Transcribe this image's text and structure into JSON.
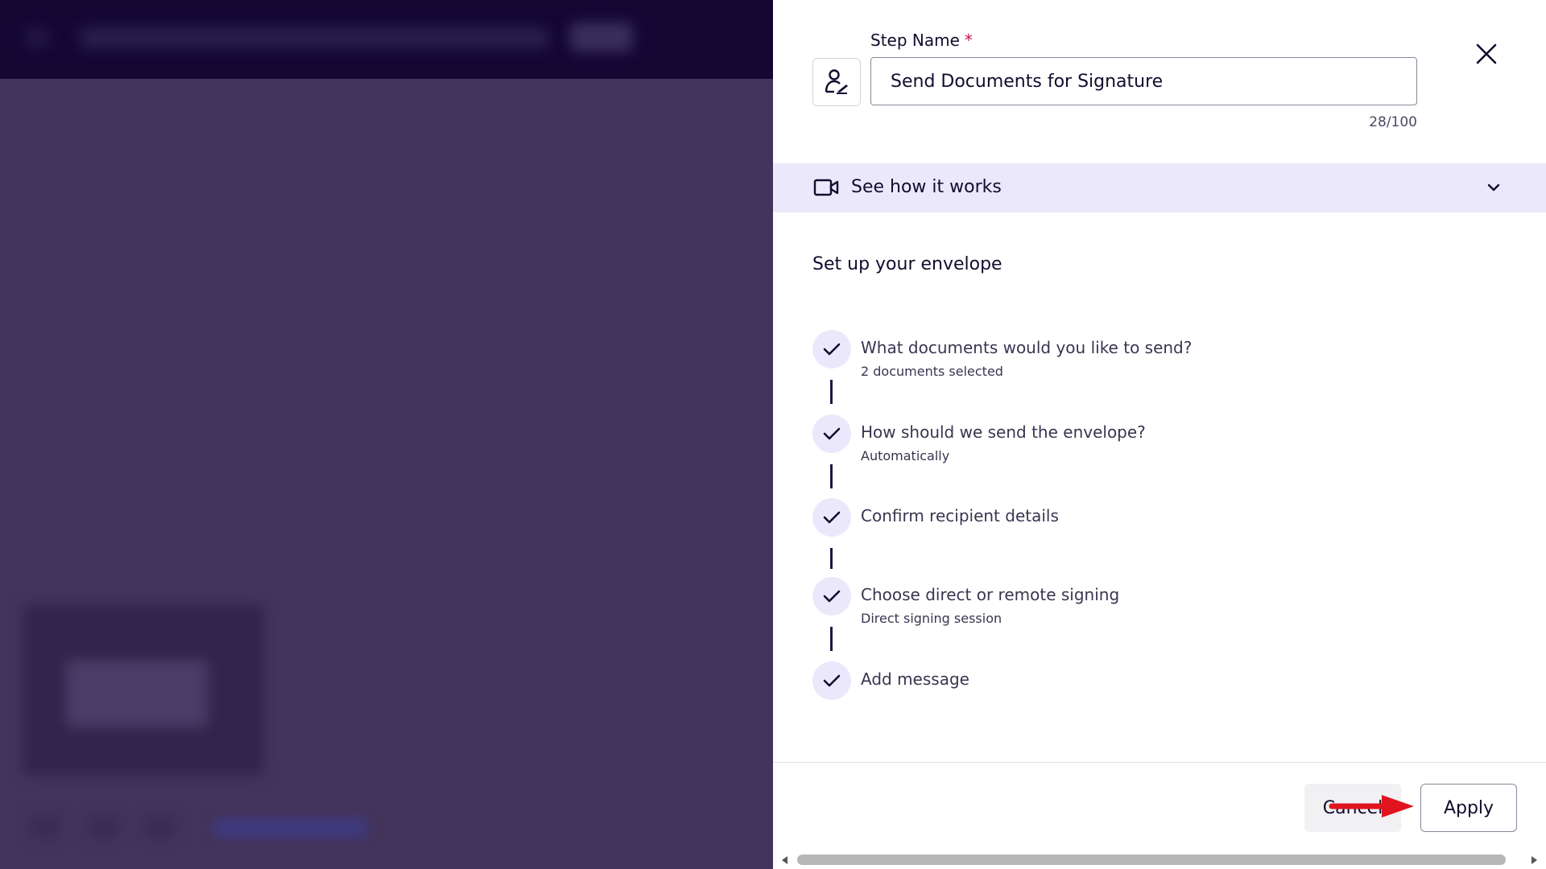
{
  "step_name": {
    "label": "Step Name",
    "required_mark": "*",
    "value": "Send Documents for Signature",
    "char_count": "28/100"
  },
  "see_how": {
    "label": "See how it works"
  },
  "section_title": "Set up your envelope",
  "steps": [
    {
      "title": "What documents would you like to send?",
      "subtitle": "2 documents selected"
    },
    {
      "title": "How should we send the envelope?",
      "subtitle": "Automatically"
    },
    {
      "title": "Confirm recipient details",
      "subtitle": ""
    },
    {
      "title": "Choose direct or remote signing",
      "subtitle": "Direct signing session"
    },
    {
      "title": "Add message",
      "subtitle": ""
    }
  ],
  "footer": {
    "cancel_label": "Cancel",
    "apply_label": "Apply"
  },
  "icons": {
    "step_icon": "person-sign-icon",
    "close": "close-icon",
    "video": "video-camera-icon",
    "chevron": "chevron-down-icon",
    "check": "check-icon"
  },
  "colors": {
    "accent_light": "#ece8fc",
    "text_primary": "#130c2e",
    "required": "#c4124f",
    "overlay": "#42345a",
    "annotation_arrow": "#e0141e"
  }
}
